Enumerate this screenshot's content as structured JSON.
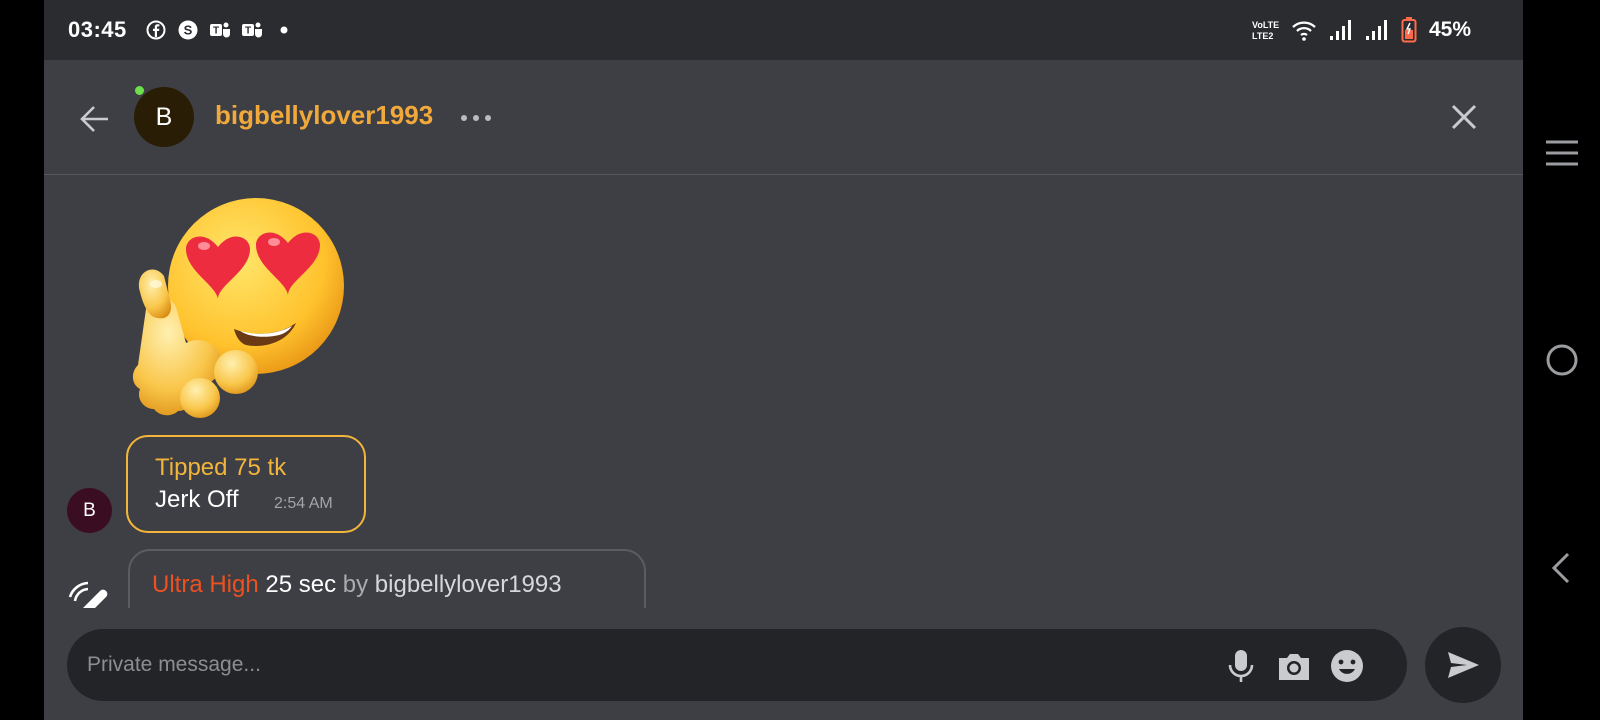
{
  "status_bar": {
    "time": "03:45",
    "notifications": [
      "facebook-icon",
      "skype-icon",
      "teams-icon",
      "teams-icon",
      "dot-icon"
    ],
    "network_label": "VoLTE LTE2",
    "battery_percent": "45%"
  },
  "header": {
    "avatar_initial": "B",
    "username": "bigbellylover1993",
    "online": true
  },
  "messages": {
    "sticker": "heart-eyes-emoji-sticker",
    "tip": {
      "avatar_initial": "B",
      "title": "Tipped 75 tk",
      "message": "Jerk Off",
      "time": "2:54 AM"
    },
    "vibration": {
      "level": "Ultra High",
      "duration": "25 sec",
      "by_label": "by",
      "username": "bigbellylover1993"
    }
  },
  "input": {
    "placeholder": "Private message..."
  },
  "colors": {
    "accent": "#f2a93b",
    "tip_border": "#f2b53c",
    "vibe_level": "#ee5020",
    "background": "#3d3f44",
    "online": "#6ee04a"
  }
}
